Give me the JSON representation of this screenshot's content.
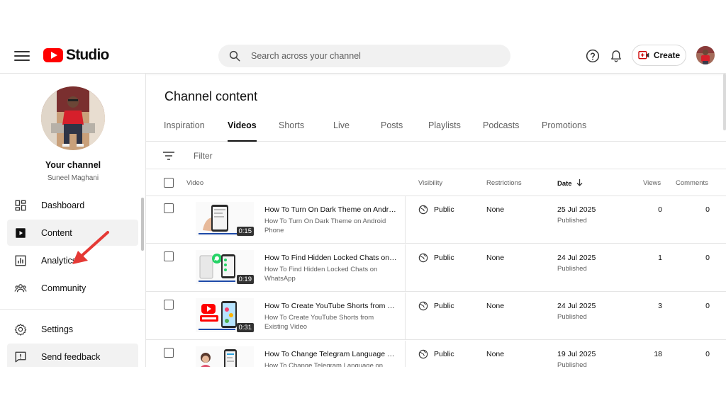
{
  "header": {
    "logo_text": "Studio",
    "search_placeholder": "Search across your channel",
    "create_label": "Create",
    "icons": [
      "menu-icon",
      "youtube-logo",
      "search-icon",
      "help-icon",
      "bell-icon",
      "create-icon",
      "avatar"
    ]
  },
  "sidebar": {
    "channel_name": "Your channel",
    "channel_handle": "Suneel Maghani",
    "items": [
      {
        "label": "Dashboard",
        "icon": "dashboard-icon"
      },
      {
        "label": "Content",
        "icon": "content-icon",
        "active": true
      },
      {
        "label": "Analytics",
        "icon": "analytics-icon"
      },
      {
        "label": "Community",
        "icon": "community-icon"
      },
      {
        "label": "Settings",
        "icon": "gear-icon"
      },
      {
        "label": "Send feedback",
        "icon": "feedback-icon"
      }
    ]
  },
  "main": {
    "title": "Channel content",
    "tabs": [
      "Inspiration",
      "Videos",
      "Shorts",
      "Live",
      "Posts",
      "Playlists",
      "Podcasts",
      "Promotions"
    ],
    "active_tab": "Videos",
    "filter_label": "Filter",
    "columns": {
      "video": "Video",
      "visibility": "Visibility",
      "restrictions": "Restrictions",
      "date": "Date",
      "views": "Views",
      "comments": "Comments"
    }
  },
  "videos": [
    {
      "title": "How To Turn On Dark Theme on Android Phone",
      "description": "How To Turn On Dark Theme on Android Phone",
      "duration": "0:15",
      "visibility": "Public",
      "restrictions": "None",
      "date": "25 Jul 2025",
      "status": "Published",
      "views": "0",
      "comments": "0"
    },
    {
      "title": "How To Find Hidden Locked Chats on WhatsApp",
      "description": "How To Find Hidden Locked Chats on WhatsApp",
      "duration": "0:19",
      "visibility": "Public",
      "restrictions": "None",
      "date": "24 Jul 2025",
      "status": "Published",
      "views": "1",
      "comments": "0"
    },
    {
      "title": "How To Create YouTube Shorts from Existing Video",
      "description": "How To Create YouTube Shorts from Existing Video",
      "duration": "0:31",
      "visibility": "Public",
      "restrictions": "None",
      "date": "24 Jul 2025",
      "status": "Published",
      "views": "3",
      "comments": "0"
    },
    {
      "title": "How To Change Telegram Language on Android",
      "description": "How To Change Telegram Language on Android",
      "duration": "",
      "visibility": "Public",
      "restrictions": "None",
      "date": "19 Jul 2025",
      "status": "Published",
      "views": "18",
      "comments": "0"
    }
  ],
  "colors": {
    "brand_red": "#ff0000",
    "text_primary": "#0f0f0f",
    "text_secondary": "#606060",
    "active_bg": "#f2f2f2",
    "annotation_arrow": "#e53935"
  }
}
